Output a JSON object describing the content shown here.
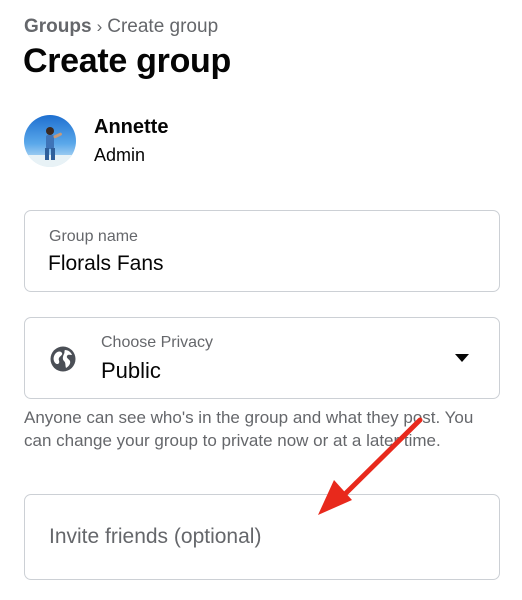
{
  "breadcrumb": {
    "root": "Groups",
    "separator": "›",
    "current": "Create group"
  },
  "page_title": "Create group",
  "admin": {
    "name": "Annette",
    "role": "Admin"
  },
  "group_name_field": {
    "label": "Group name",
    "value": "Florals Fans"
  },
  "privacy_field": {
    "label": "Choose Privacy",
    "value": "Public",
    "icon": "globe-icon"
  },
  "privacy_help": "Anyone can see who's in the group and what they post. You can change your group to private now or at a later time.",
  "invite_field": {
    "placeholder": "Invite friends (optional)",
    "value": ""
  },
  "annotation": {
    "type": "arrow",
    "color": "#e8291c"
  },
  "colors": {
    "text_primary": "#050505",
    "text_secondary": "#65676b",
    "border": "#ccd0d5"
  }
}
